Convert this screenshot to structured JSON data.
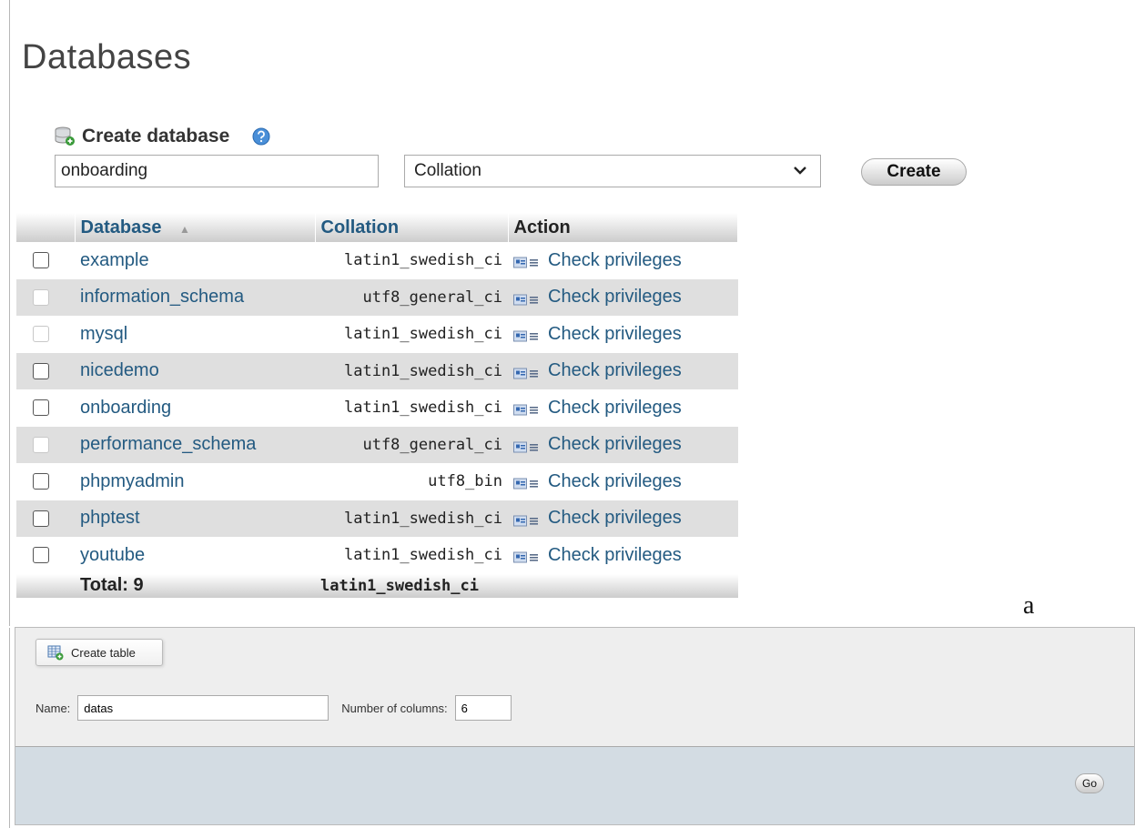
{
  "page_title": "Databases",
  "create_database": {
    "heading": "Create database",
    "name_value": "onboarding",
    "collation_placeholder": "Collation",
    "create_label": "Create"
  },
  "table": {
    "headers": {
      "database": "Database",
      "collation": "Collation",
      "action": "Action"
    },
    "rows": [
      {
        "name": "example",
        "collation": "latin1_swedish_ci",
        "action": "Check privileges",
        "checkbox_enabled": true
      },
      {
        "name": "information_schema",
        "collation": "utf8_general_ci",
        "action": "Check privileges",
        "checkbox_enabled": false
      },
      {
        "name": "mysql",
        "collation": "latin1_swedish_ci",
        "action": "Check privileges",
        "checkbox_enabled": false
      },
      {
        "name": "nicedemo",
        "collation": "latin1_swedish_ci",
        "action": "Check privileges",
        "checkbox_enabled": true
      },
      {
        "name": "onboarding",
        "collation": "latin1_swedish_ci",
        "action": "Check privileges",
        "checkbox_enabled": true
      },
      {
        "name": "performance_schema",
        "collation": "utf8_general_ci",
        "action": "Check privileges",
        "checkbox_enabled": false
      },
      {
        "name": "phpmyadmin",
        "collation": "utf8_bin",
        "action": "Check privileges",
        "checkbox_enabled": true
      },
      {
        "name": "phptest",
        "collation": "latin1_swedish_ci",
        "action": "Check privileges",
        "checkbox_enabled": true
      },
      {
        "name": "youtube",
        "collation": "latin1_swedish_ci",
        "action": "Check privileges",
        "checkbox_enabled": true
      }
    ],
    "total_label": "Total: 9",
    "total_collation": "latin1_swedish_ci"
  },
  "caption": "a",
  "create_table": {
    "legend": "Create table",
    "name_label": "Name:",
    "name_value": "datas",
    "columns_label": "Number of columns:",
    "columns_value": "6",
    "go_label": "Go"
  },
  "colors": {
    "link": "#235a81",
    "row_alt": "#dfdfdf",
    "footer_bar": "#d3dce3"
  }
}
